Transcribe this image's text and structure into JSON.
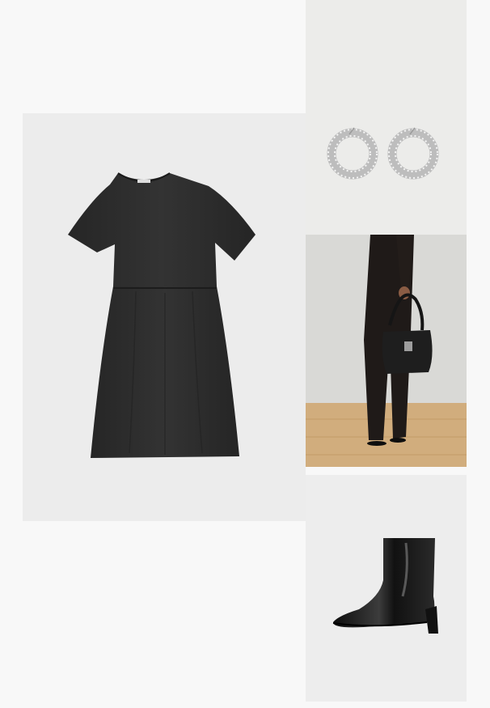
{
  "layout_items": [
    {
      "id": "dress",
      "product": "black-short-sleeve-smock-dress",
      "color": "#2a2a2a"
    },
    {
      "id": "earrings",
      "product": "silver-crystal-hoop-earrings",
      "color": "#c9c9c9"
    },
    {
      "id": "bag",
      "product": "black-leather-shoulder-bag",
      "color": "#1e1e1e"
    },
    {
      "id": "boot",
      "product": "black-patent-ankle-boot",
      "color": "#151515"
    }
  ],
  "colors": {
    "page_background": "#f8f8f8",
    "tile_background": "#ececec",
    "garment": "#2a2a2a",
    "floor": "#d1ad7d"
  }
}
